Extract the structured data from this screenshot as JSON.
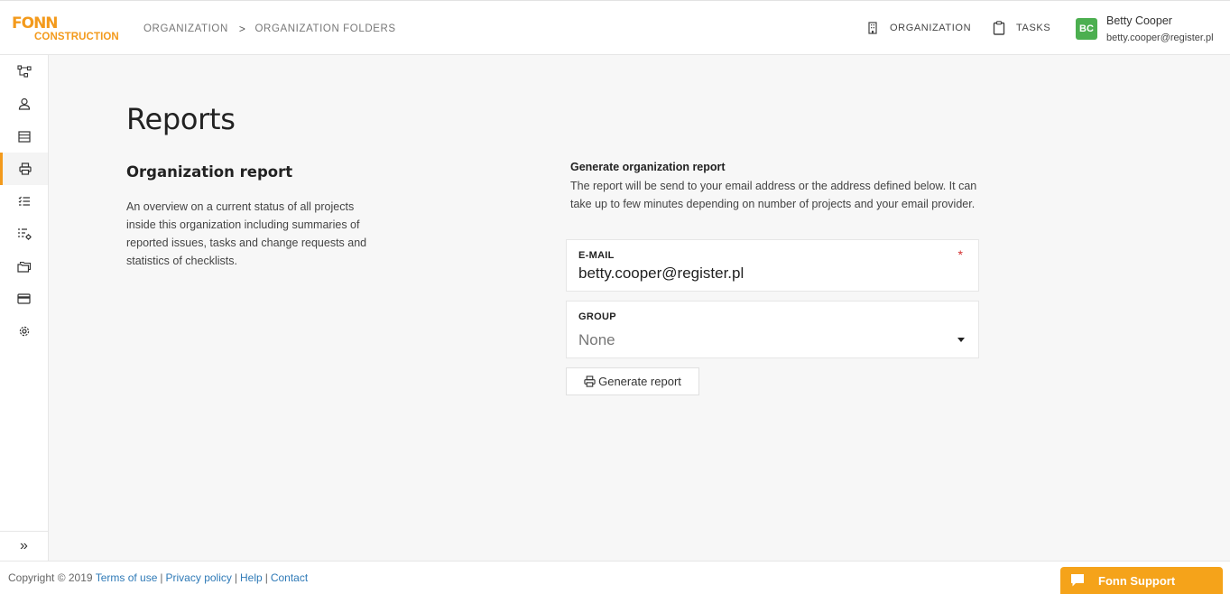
{
  "brand": {
    "logo_top": "FONN",
    "logo_bottom": "CONSTRUCTION",
    "accent": "#f39a1c"
  },
  "breadcrumb": {
    "items": [
      "ORGANIZATION",
      "ORGANIZATION FOLDERS"
    ],
    "separator": ">"
  },
  "top_nav": {
    "organization_label": "ORGANIZATION",
    "organization_icon": "building-icon",
    "tasks_label": "TASKS",
    "tasks_icon": "clipboard-icon"
  },
  "user": {
    "initials": "BC",
    "name": "Betty Cooper",
    "email": "betty.cooper@register.pl",
    "avatar_color": "#4caf50"
  },
  "sidebar": {
    "items": [
      {
        "icon": "hierarchy-icon",
        "active": false
      },
      {
        "icon": "user-icon",
        "active": false
      },
      {
        "icon": "table-icon",
        "active": false
      },
      {
        "icon": "printer-icon",
        "active": true
      },
      {
        "icon": "checklist-icon",
        "active": false
      },
      {
        "icon": "checklist-settings-icon",
        "active": false
      },
      {
        "icon": "folders-icon",
        "active": false
      },
      {
        "icon": "credit-card-icon",
        "active": false
      },
      {
        "icon": "gear-icon",
        "active": false
      }
    ],
    "expand_label": "»"
  },
  "main": {
    "title": "Reports",
    "section_title": "Organization report",
    "section_description": "An overview on a current status of all projects inside this organization including summaries of reported issues, tasks and change requests and statistics of checklists.",
    "form": {
      "title": "Generate organization report",
      "description": "The report will be send to your email address or the address defined below. It can take up to few minutes depending on number of projects and your email provider.",
      "email_label": "E-MAIL",
      "email_required": "*",
      "email_value": "betty.cooper@register.pl",
      "group_label": "GROUP",
      "group_value": "None",
      "submit_label": "Generate report"
    }
  },
  "footer": {
    "copyright": "Copyright © 2019",
    "links": [
      "Terms of use",
      "Privacy policy",
      "Help",
      "Contact"
    ],
    "link_color": "#2f7ab7"
  },
  "support": {
    "label": "Fonn Support",
    "color": "#f5a31a"
  }
}
